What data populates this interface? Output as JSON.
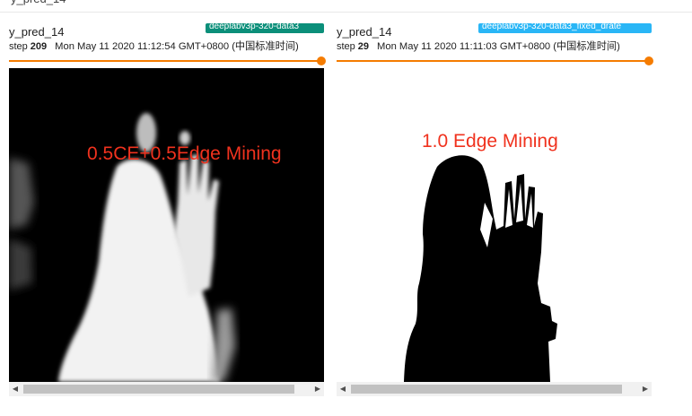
{
  "page": {
    "header_text": "y_pred_14"
  },
  "cards": [
    {
      "tag": "y_pred_14",
      "run": "deeplabv3p-320-data3",
      "run_color": "#0b8f7a",
      "step_label": "step",
      "step": "209",
      "timestamp": "Mon May 11 2020 11:12:54 GMT+0800 (中国标准时间)",
      "overlay_text": "0.5CE+0.5Edge Mining",
      "slider_position": 1.0
    },
    {
      "tag": "y_pred_14",
      "run": "deeplabv3p-320-data3_fixed_drate",
      "run_color": "#29b6f6",
      "step_label": "step",
      "step": "29",
      "timestamp": "Mon May 11 2020 11:11:03 GMT+0800 (中国标准时间)",
      "overlay_text": "1.0 Edge Mining",
      "slider_position": 1.0
    }
  ],
  "icons": {
    "scroll_left": "triangle-left-icon",
    "scroll_right": "triangle-right-icon"
  },
  "colors": {
    "accent": "#f57c00",
    "overlay_text": "#f0321e"
  }
}
